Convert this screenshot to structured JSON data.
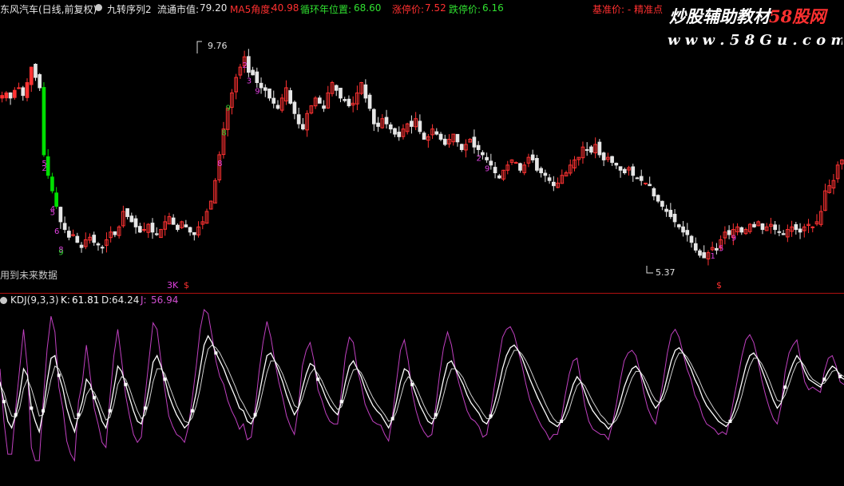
{
  "header": {
    "stock_name": "东风汽车(日线,前复权)",
    "indicator_name": "九转序列2",
    "circulating_label": "流通市值:",
    "circulating_value": "79.20",
    "ma5_label": "MA5角度:",
    "ma5_value": "40.98",
    "cycle_label": "循环年位置:",
    "cycle_value": "68.60",
    "limit_up_label": "涨停价:",
    "limit_up_value": "7.52",
    "limit_down_label": "跌停价:",
    "limit_down_value": "6.16",
    "extra_text": "基准价: - 精准点"
  },
  "watermark": {
    "title": "炒股辅助教材",
    "brand": "58股网",
    "url": "w w w . 5 8 G u . c o m"
  },
  "price_panel": {
    "note": "用到未来数据",
    "high_label": "9.76",
    "low_label": "5.37",
    "marker_a": "3K",
    "marker_b": "$",
    "marker_c": "$"
  },
  "kdj_panel": {
    "name": "KDJ(9,3,3)",
    "k_label": "K:",
    "k_value": "61.81",
    "d_label": "D:",
    "d_value": "64.24",
    "j_label": "J:",
    "j_value": "56.94"
  },
  "colors": {
    "up": "#ff3232",
    "down": "#e6e6e6",
    "green_bar": "#00e000",
    "k_line": "#ffffff",
    "d_line": "#d0d0d0",
    "j_line": "#c040c0",
    "seq_down": "#e040e0",
    "seq_up": "#30d030"
  },
  "chart_data": [
    {
      "type": "candlestick",
      "ylim": [
        5.2,
        10.0
      ],
      "high_mark": 9.76,
      "low_mark": 5.37,
      "closes": [
        8.55,
        8.6,
        8.5,
        8.65,
        8.7,
        8.55,
        8.8,
        9.1,
        8.9,
        8.7,
        7.4,
        7.0,
        6.7,
        6.4,
        6.1,
        5.95,
        5.8,
        5.85,
        5.7,
        5.6,
        5.75,
        5.8,
        5.7,
        5.65,
        5.6,
        5.75,
        5.9,
        5.85,
        6.0,
        6.3,
        6.2,
        6.1,
        6.0,
        5.9,
        5.95,
        6.05,
        5.9,
        5.85,
        5.95,
        6.1,
        6.2,
        6.05,
        5.95,
        6.1,
        6.0,
        5.9,
        5.85,
        6.0,
        6.1,
        6.3,
        6.5,
        6.9,
        7.4,
        7.9,
        8.3,
        8.6,
        8.9,
        9.1,
        9.3,
        9.0,
        8.95,
        8.8,
        8.7,
        8.65,
        8.5,
        8.4,
        8.3,
        8.5,
        8.7,
        8.4,
        8.2,
        8.0,
        7.9,
        8.2,
        8.35,
        8.5,
        8.4,
        8.3,
        8.6,
        8.8,
        8.65,
        8.5,
        8.45,
        8.35,
        8.4,
        8.6,
        8.8,
        8.5,
        8.3,
        8.0,
        7.95,
        8.1,
        8.0,
        7.9,
        7.8,
        7.75,
        7.9,
        8.0,
        7.95,
        8.1,
        7.85,
        7.7,
        7.75,
        7.9,
        7.8,
        7.7,
        7.6,
        7.7,
        7.8,
        7.65,
        7.5,
        7.6,
        7.7,
        7.55,
        7.5,
        7.4,
        7.3,
        7.2,
        7.05,
        6.95,
        7.1,
        7.2,
        7.3,
        7.25,
        7.1,
        7.2,
        7.35,
        7.3,
        7.1,
        7.05,
        7.0,
        6.9,
        6.8,
        6.85,
        7.0,
        7.05,
        7.2,
        7.3,
        7.35,
        7.55,
        7.5,
        7.45,
        7.6,
        7.4,
        7.3,
        7.35,
        7.25,
        7.2,
        7.1,
        7.05,
        7.15,
        7.0,
        6.95,
        6.9,
        6.85,
        6.8,
        6.6,
        6.5,
        6.4,
        6.3,
        6.2,
        6.1,
        6.0,
        5.9,
        5.85,
        5.7,
        5.55,
        5.45,
        5.4,
        5.5,
        5.6,
        5.55,
        5.75,
        5.9,
        5.85,
        5.95,
        6.0,
        5.9,
        5.95,
        6.05,
        6.0,
        6.1,
        5.95,
        6.0,
        6.05,
        5.95,
        5.9,
        5.85,
        5.95,
        6.0,
        5.95,
        5.9,
        6.0,
        6.05,
        6.0,
        6.1,
        6.3,
        6.7,
        6.8,
        6.9,
        7.2,
        7.3
      ]
    },
    {
      "type": "line",
      "title": "KDJ(9,3,3)",
      "ylim": [
        -15,
        115
      ],
      "series": [
        {
          "name": "K",
          "values": [
            60,
            45,
            30,
            25,
            35,
            50,
            70,
            65,
            40,
            30,
            22,
            38,
            60,
            78,
            80,
            65,
            55,
            40,
            30,
            22,
            35,
            45,
            62,
            58,
            48,
            40,
            30,
            25,
            38,
            55,
            72,
            68,
            58,
            48,
            38,
            30,
            28,
            40,
            56,
            75,
            80,
            72,
            62,
            50,
            42,
            35,
            30,
            25,
            28,
            38,
            52,
            70,
            88,
            95,
            90,
            82,
            76,
            70,
            62,
            55,
            48,
            40,
            38,
            30,
            28,
            35,
            50,
            66,
            80,
            82,
            76,
            68,
            60,
            50,
            42,
            35,
            40,
            55,
            66,
            74,
            72,
            62,
            56,
            48,
            42,
            38,
            35,
            45,
            60,
            72,
            76,
            70,
            64,
            55,
            48,
            42,
            38,
            35,
            30,
            25,
            32,
            45,
            60,
            70,
            68,
            58,
            50,
            42,
            36,
            30,
            28,
            35,
            48,
            62,
            74,
            76,
            70,
            64,
            58,
            50,
            44,
            40,
            36,
            30,
            28,
            34,
            44,
            56,
            70,
            80,
            86,
            88,
            84,
            78,
            70,
            62,
            55,
            48,
            42,
            36,
            30,
            28,
            26,
            30,
            38,
            48,
            58,
            64,
            60,
            52,
            44,
            38,
            34,
            30,
            28,
            24,
            28,
            35,
            45,
            56,
            64,
            70,
            72,
            68,
            60,
            52,
            45,
            40,
            44,
            52,
            64,
            76,
            84,
            86,
            82,
            76,
            70,
            62,
            56,
            48,
            42,
            38,
            34,
            30,
            28,
            26,
            30,
            38,
            48,
            60,
            72,
            80,
            82,
            78,
            70,
            62,
            54,
            46,
            40,
            44,
            56,
            66,
            74,
            80,
            76,
            68,
            62,
            60,
            58,
            56,
            62,
            68,
            72,
            70,
            64,
            62
          ]
        },
        {
          "name": "D",
          "values": [
            58,
            52,
            42,
            34,
            33,
            40,
            55,
            62,
            55,
            45,
            34,
            35,
            48,
            62,
            72,
            70,
            63,
            52,
            42,
            32,
            32,
            38,
            50,
            55,
            52,
            46,
            38,
            31,
            33,
            43,
            58,
            64,
            62,
            55,
            46,
            38,
            32,
            35,
            45,
            60,
            70,
            70,
            66,
            58,
            50,
            42,
            36,
            30,
            29,
            33,
            42,
            55,
            72,
            85,
            88,
            86,
            82,
            76,
            70,
            63,
            56,
            48,
            43,
            37,
            32,
            33,
            41,
            54,
            67,
            76,
            76,
            72,
            66,
            58,
            50,
            42,
            40,
            47,
            57,
            66,
            70,
            66,
            61,
            54,
            48,
            43,
            39,
            41,
            50,
            61,
            69,
            70,
            67,
            61,
            54,
            48,
            43,
            39,
            35,
            30,
            31,
            37,
            48,
            59,
            64,
            61,
            56,
            49,
            42,
            36,
            32,
            32,
            39,
            50,
            62,
            70,
            70,
            67,
            63,
            56,
            50,
            45,
            41,
            36,
            32,
            32,
            37,
            46,
            58,
            70,
            78,
            84,
            84,
            81,
            76,
            70,
            63,
            56,
            50,
            43,
            37,
            32,
            29,
            29,
            32,
            39,
            49,
            57,
            60,
            57,
            51,
            45,
            40,
            35,
            32,
            28,
            28,
            31,
            37,
            46,
            55,
            63,
            68,
            68,
            64,
            58,
            51,
            46,
            44,
            47,
            55,
            66,
            76,
            82,
            82,
            79,
            74,
            68,
            62,
            55,
            49,
            44,
            39,
            35,
            31,
            29,
            29,
            33,
            40,
            50,
            62,
            72,
            78,
            78,
            74,
            68,
            61,
            53,
            46,
            45,
            50,
            58,
            67,
            74,
            76,
            72,
            66,
            62,
            60,
            58,
            59,
            63,
            68,
            69,
            66,
            64
          ]
        },
        {
          "name": "J",
          "values": [
            70,
            30,
            5,
            5,
            40,
            70,
            100,
            70,
            10,
            0,
            0,
            45,
            85,
            110,
            98,
            56,
            40,
            15,
            5,
            0,
            45,
            60,
            88,
            64,
            40,
            28,
            14,
            10,
            48,
            80,
            100,
            76,
            50,
            34,
            20,
            14,
            18,
            50,
            78,
            105,
            100,
            76,
            54,
            34,
            26,
            20,
            18,
            14,
            26,
            48,
            72,
            100,
            115,
            112,
            95,
            76,
            64,
            58,
            46,
            38,
            32,
            24,
            28,
            16,
            18,
            40,
            68,
            90,
            106,
            94,
            76,
            60,
            48,
            34,
            26,
            20,
            40,
            72,
            84,
            90,
            76,
            54,
            46,
            36,
            30,
            28,
            28,
            53,
            80,
            94,
            90,
            70,
            58,
            43,
            36,
            30,
            28,
            27,
            20,
            15,
            34,
            60,
            84,
            92,
            76,
            52,
            38,
            28,
            22,
            18,
            20,
            41,
            66,
            86,
            98,
            88,
            70,
            58,
            48,
            38,
            32,
            30,
            26,
            18,
            20,
            38,
            58,
            76,
            94,
            100,
            102,
            96,
            84,
            72,
            58,
            46,
            39,
            32,
            26,
            22,
            16,
            20,
            20,
            32,
            50,
            66,
            76,
            78,
            60,
            42,
            30,
            24,
            22,
            20,
            20,
            16,
            28,
            43,
            61,
            76,
            82,
            84,
            80,
            68,
            52,
            40,
            33,
            28,
            44,
            62,
            82,
            96,
            100,
            94,
            82,
            70,
            62,
            50,
            44,
            34,
            28,
            26,
            24,
            20,
            22,
            20,
            32,
            48,
            64,
            80,
            92,
            96,
            90,
            78,
            62,
            50,
            40,
            32,
            28,
            42,
            68,
            82,
            88,
            92,
            76,
            60,
            54,
            56,
            54,
            52,
            68,
            78,
            80,
            72,
            60,
            58
          ]
        }
      ]
    }
  ]
}
